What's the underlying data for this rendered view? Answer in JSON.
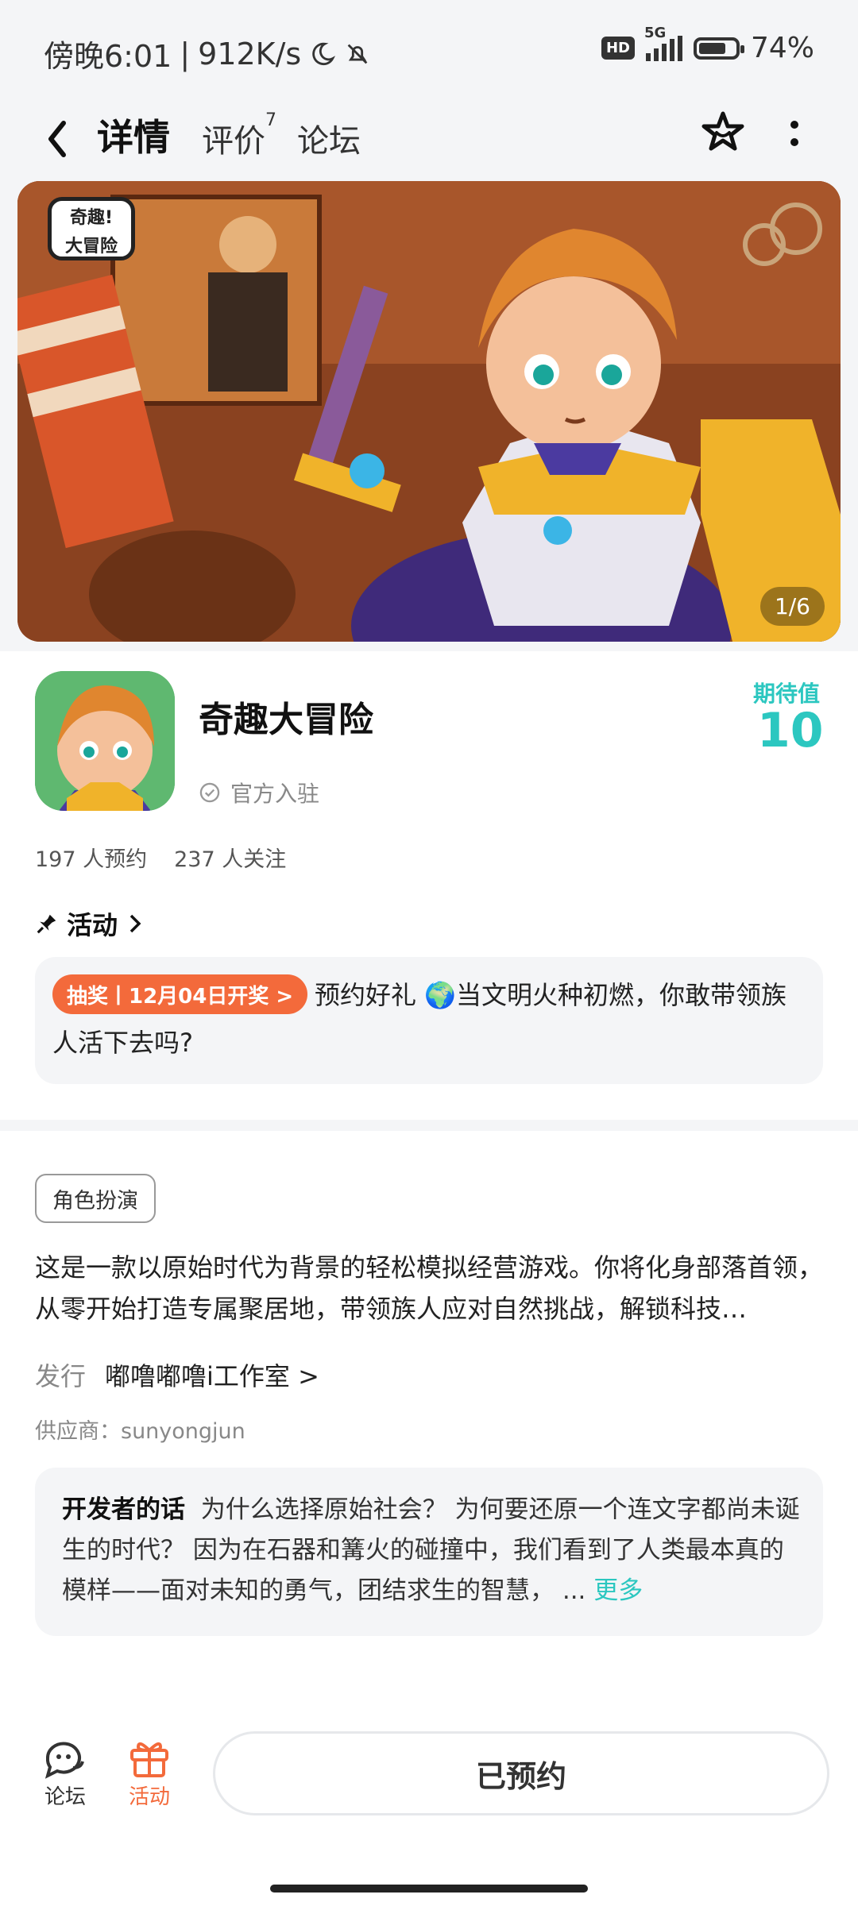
{
  "status_bar": {
    "time": "傍晚6:01",
    "speed": "912K/s",
    "hd": "HD",
    "network": "5G",
    "battery": "74%",
    "battery_level": 0.74
  },
  "nav": {
    "tabs": [
      {
        "label": "详情",
        "active": true
      },
      {
        "label": "评价",
        "badge": "7"
      },
      {
        "label": "论坛"
      }
    ],
    "icons": [
      "back-icon",
      "star-icon",
      "more-icon"
    ]
  },
  "hero": {
    "logo_text": "奇趣!大冒险",
    "page_indicator": "1/6"
  },
  "app": {
    "name": "奇趣大冒险",
    "official_label": "官方入驻",
    "expect_label": "期待值",
    "expect_value": "10",
    "reservations": "197 人预约",
    "followers": "237 人关注"
  },
  "activity": {
    "title": "活动",
    "lottery_pill": "抽奖丨12月04日开奖 >",
    "text": "预约好礼 🌍当文明火种初燃，你敢带领族人活下去吗?"
  },
  "details": {
    "genre": "角色扮演",
    "description": "这是一款以原始时代为背景的轻松模拟经营游戏。你将化身部落首领，从零开始打造专属聚居地，带领族人应对自然挑战，解锁科技…",
    "publisher_label": "发行",
    "publisher_name": "嘟噜嘟噜i工作室 >",
    "supplier": "供应商：sunyongjun",
    "developer_label": "开发者的话",
    "developer_text": "为什么选择原始社会？ 为何要还原一个连文字都尚未诞生的时代？ 因为在石器和篝火的碰撞中，我们看到了人类最本真的模样——面对未知的勇气，团结求生的智慧， ...",
    "more_label": "更多"
  },
  "bottom": {
    "forum_label": "论坛",
    "activity_label": "活动",
    "reserved_label": "已预约"
  },
  "colors": {
    "accent": "#2cc7c0",
    "orange": "#f36a3b"
  }
}
